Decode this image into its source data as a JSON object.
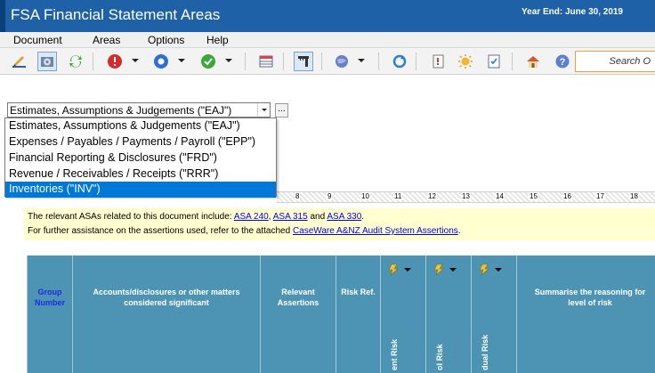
{
  "window": {
    "title": "FSA Financial Statement Areas",
    "year_end": "Year End: June 30, 2019"
  },
  "menu": [
    "Document",
    "Areas",
    "Options",
    "Help"
  ],
  "toolbar": {
    "icons": [
      "edit-icon",
      "settings-icon",
      "refresh-icon",
      "error-icon",
      "circle-icon",
      "check-icon",
      "table-icon",
      "ruler-icon",
      "globe-icon",
      "sync-icon",
      "note-icon",
      "sun-icon",
      "document-check-icon",
      "home-icon",
      "help-icon"
    ],
    "search_placeholder": "Search O"
  },
  "combo": {
    "value": "Estimates, Assumptions & Judgements (\"EAJ\")",
    "options": [
      "Estimates, Assumptions & Judgements (\"EAJ\")",
      "Expenses / Payables / Payments / Payroll (\"EPP\")",
      "Financial Reporting & Disclosures (\"FRD\")",
      "Revenue / Receivables / Receipts (\"RRR\")",
      "Inventories (\"INV\")"
    ],
    "selected_index": 4,
    "ellipsis_label": "..."
  },
  "ruler": [
    "8",
    "9",
    "10",
    "11",
    "12",
    "13",
    "14",
    "15",
    "16",
    "17",
    "18"
  ],
  "info": {
    "line1_prefix": "The relevant ASAs related to this document include: ",
    "asa1": "ASA 240",
    "sep1": ", ",
    "asa2": "ASA 315",
    "and": " and ",
    "asa3": "ASA 330",
    "end": ".",
    "line2_prefix": "For further assistance on the assertions used, refer to the attached ",
    "link": "CaseWare A&NZ Audit System Assertions",
    "line2_end": "."
  },
  "table": {
    "group_number": "Group Number",
    "accounts_header": "Accounts/disclosures or other matters considered significant",
    "assertions_header": "Relevant Assertions",
    "risk_ref_header": "Risk Ref.",
    "inherent_risk": "ent Risk",
    "control_risk": "ol Risk",
    "residual_risk": "dual Risk",
    "reasoning_header": "Summarise the reasoning for level of risk",
    "colors": {
      "header_bg": "#4d94b4",
      "group_text": "#1a2be8"
    }
  }
}
